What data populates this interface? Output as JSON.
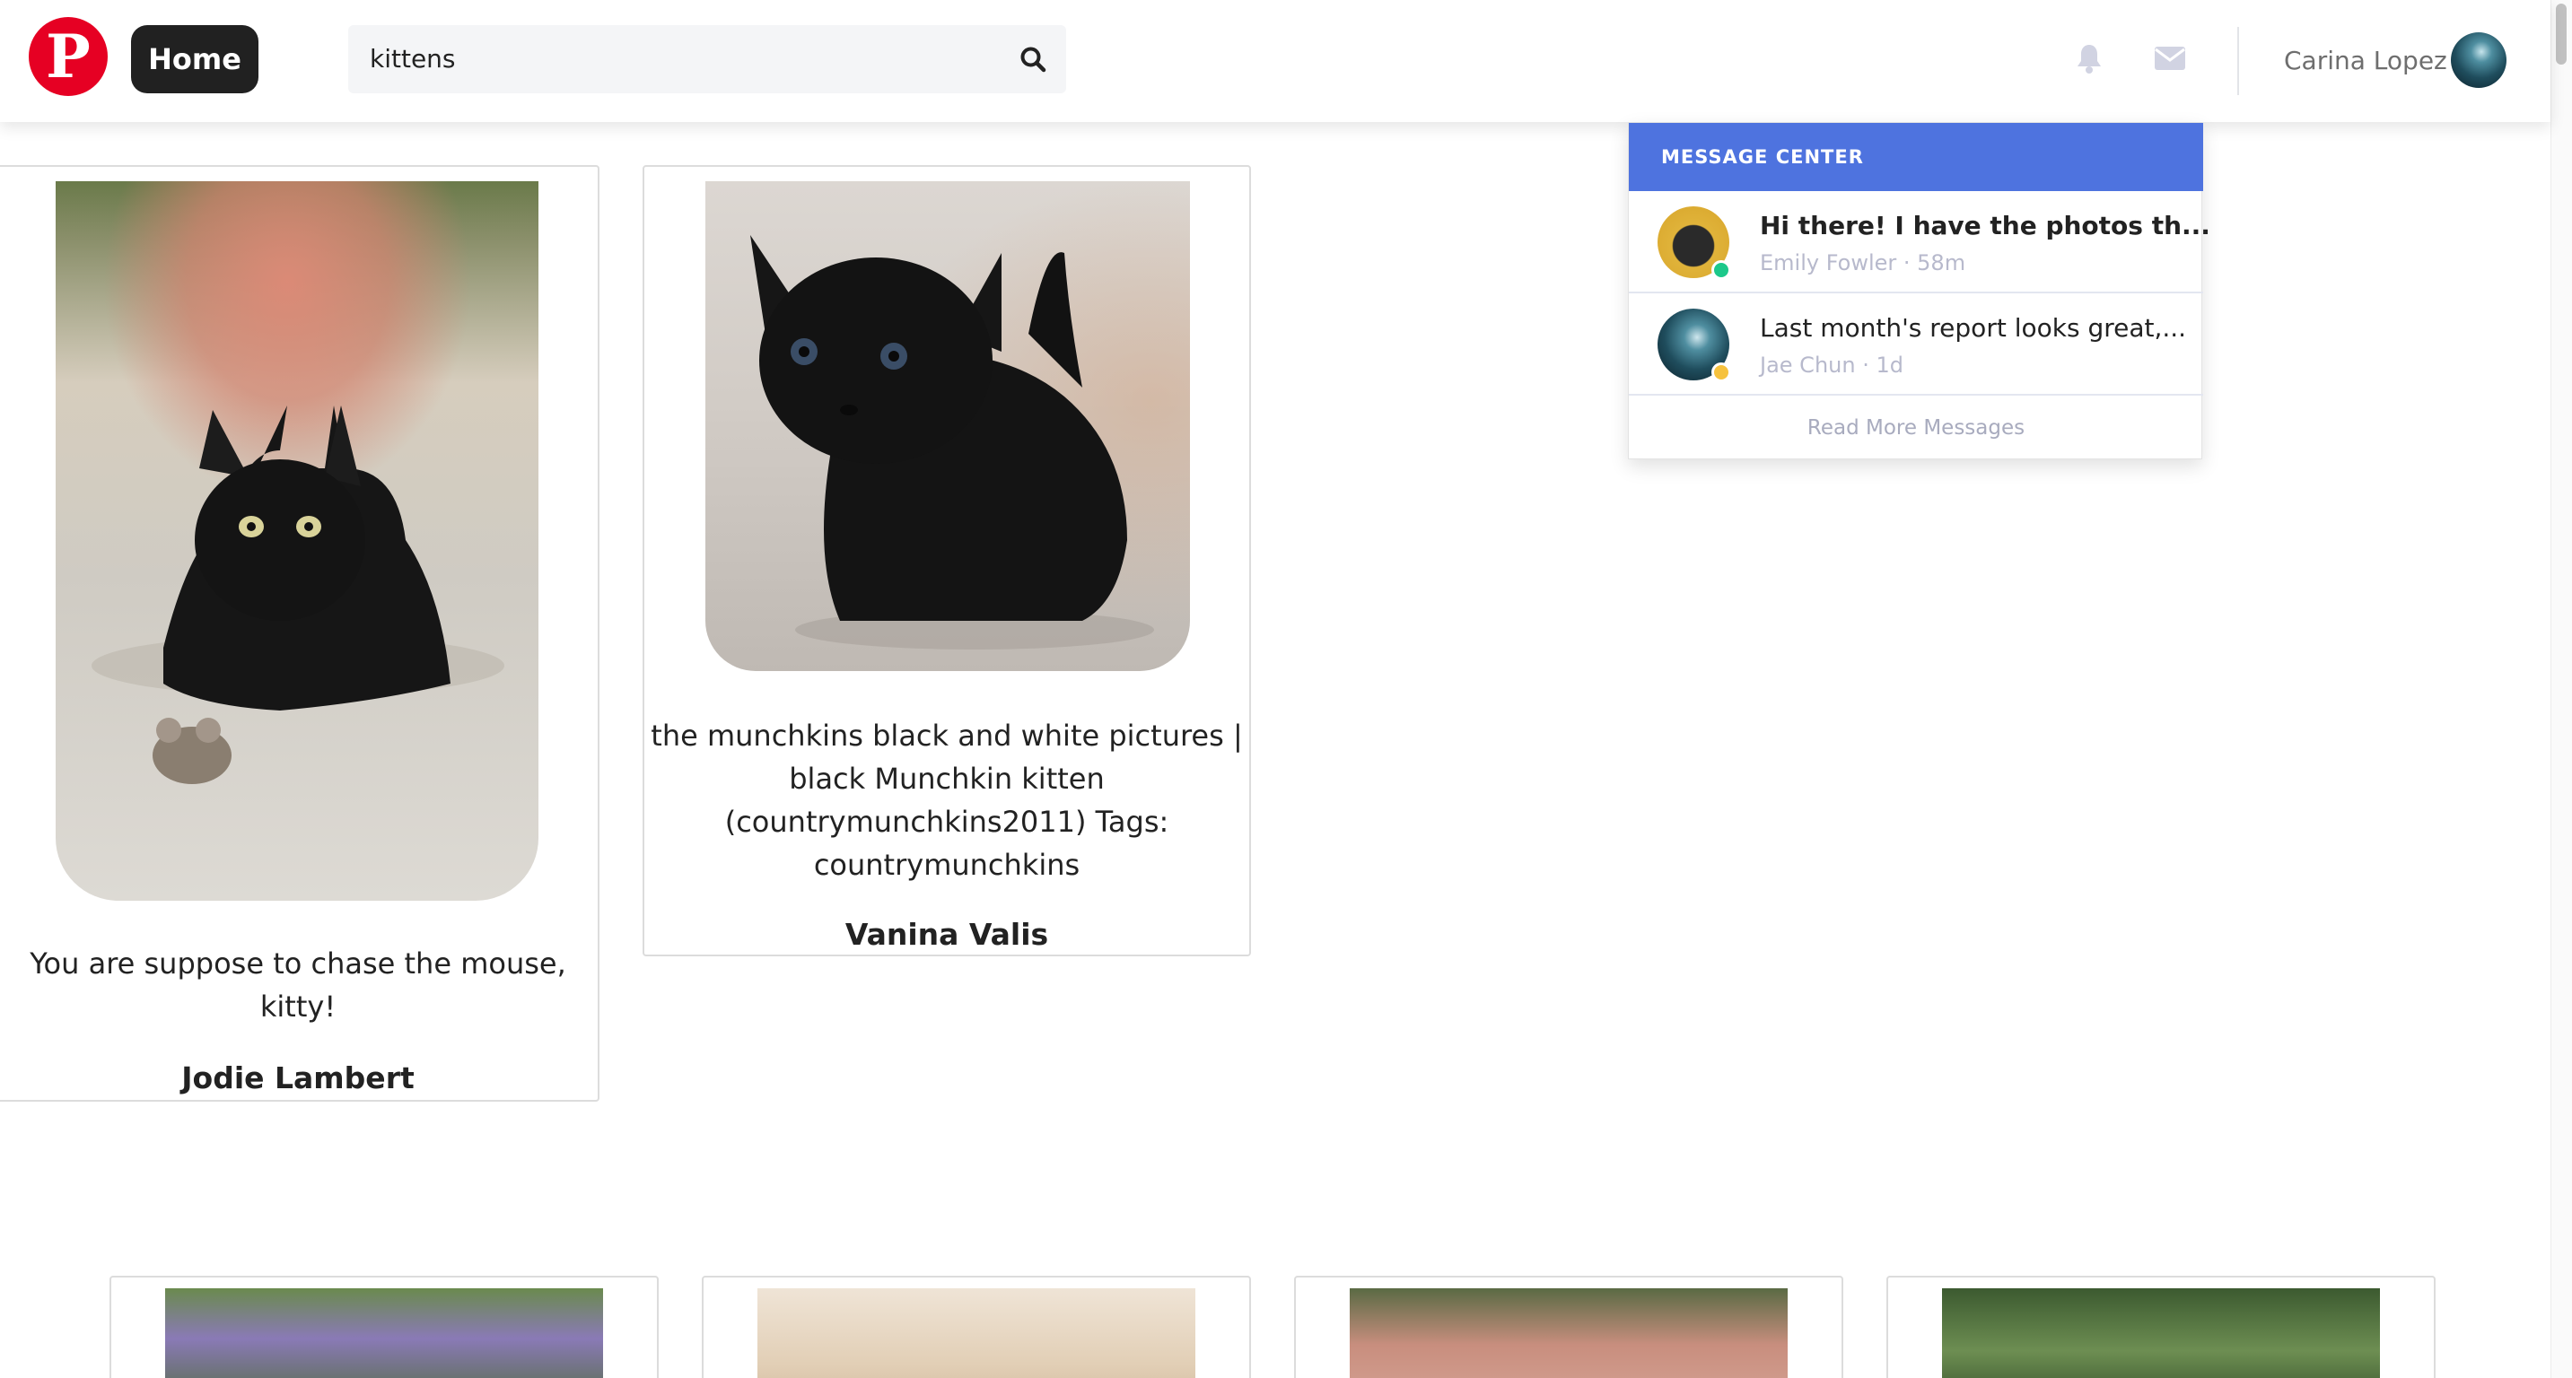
{
  "header": {
    "logo_letter": "P",
    "home_label": "Home",
    "search_value": "kittens",
    "user_name": "Carina Lopez"
  },
  "pins": [
    {
      "caption_lines": [
        "You are suppose to chase the mouse,",
        "kitty!"
      ],
      "author": "Jodie Lambert"
    },
    {
      "caption_lines": [
        "the munchkins black and white pictures |",
        "black Munchkin kitten",
        "(countrymunchkins2011) Tags:",
        "countrymunchkins"
      ],
      "author": "Vanina Valis"
    }
  ],
  "message_center": {
    "title": "MESSAGE CENTER",
    "messages": [
      {
        "text": "Hi there! I have the photos th...",
        "meta": "Emily Fowler · 58m",
        "unread": true,
        "status_color": "#1cc88a"
      },
      {
        "text": "Last month's report looks great,...",
        "meta": "Jae Chun · 1d",
        "unread": false,
        "status_color": "#f6c23e"
      }
    ],
    "footer": "Read More Messages"
  },
  "colors": {
    "brand_red": "#e60023",
    "accent_blue": "#4e73df"
  }
}
